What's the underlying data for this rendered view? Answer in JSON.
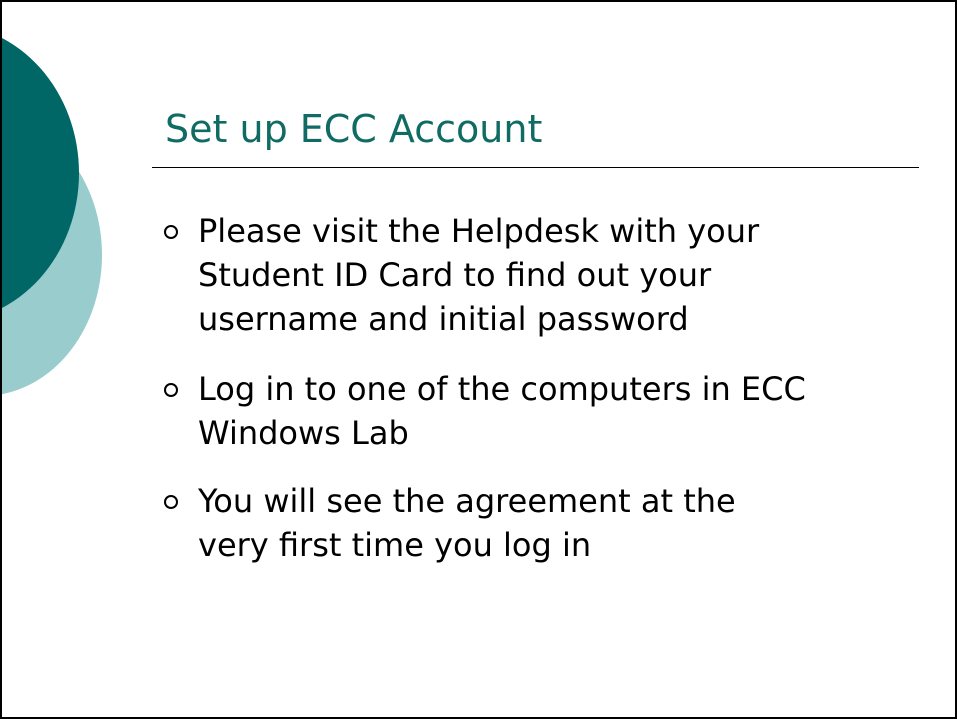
{
  "slide": {
    "title": "Set up ECC Account",
    "bullets": [
      {
        "line1": "Please visit the Helpdesk with your",
        "line2": "Student ID Card to find out your",
        "line3": "username and initial password"
      },
      {
        "line1": "Log in to one of the computers in ECC",
        "line2": "Windows Lab"
      },
      {
        "line1": "You will see the agreement at the",
        "line2": "very first time you log in"
      }
    ]
  },
  "colors": {
    "title": "#0f6b63",
    "circle_dark": "#006666",
    "circle_light": "#99cccc",
    "text": "#000000",
    "border": "#000000"
  },
  "icons": {
    "bullet_marker": "hollow-circle-bullet-icon",
    "decoration": "teal-circles-decoration"
  }
}
